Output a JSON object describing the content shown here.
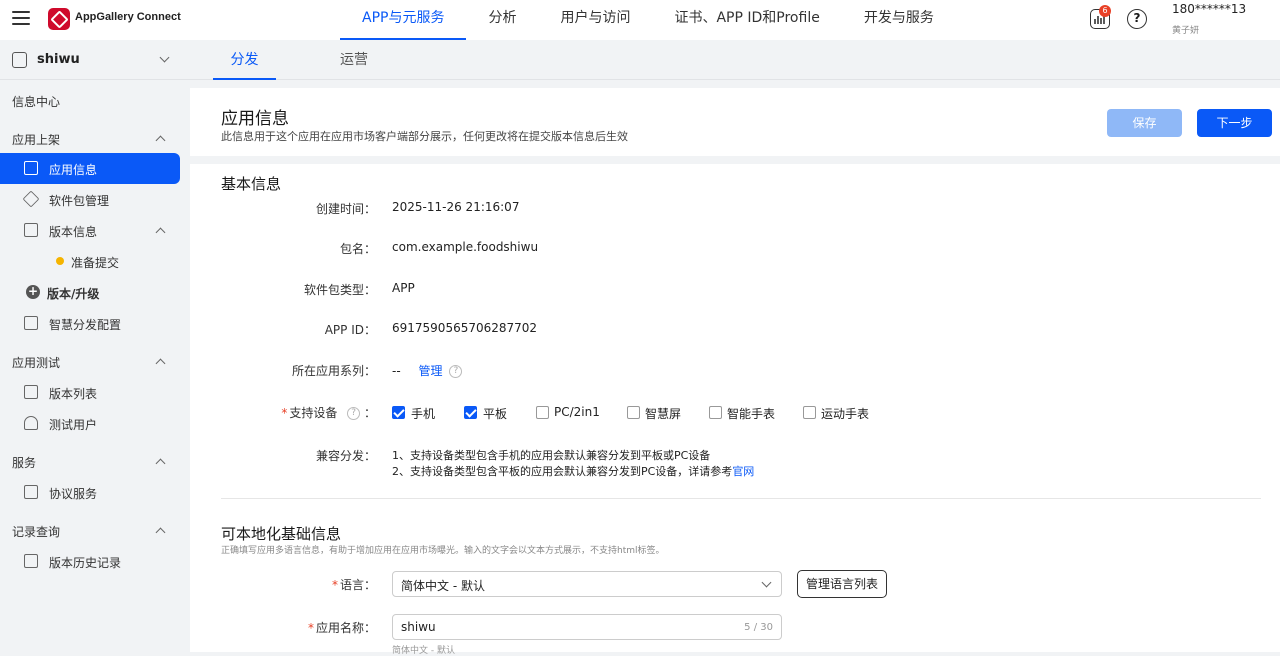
{
  "brand": "AppGallery Connect",
  "nav": {
    "items": [
      "APP与元服务",
      "分析",
      "用户与访问",
      "证书、APP ID和Profile",
      "开发与服务"
    ],
    "active": 0
  },
  "notif_count": "6",
  "help_symbol": "?",
  "user": {
    "name": "180******13",
    "sub": "黄子妍"
  },
  "sidebar": {
    "app_name": "shiwu",
    "info_center": "信息中心",
    "group_listing": "应用上架",
    "app_info": "应用信息",
    "package_mgmt": "软件包管理",
    "version_info": "版本信息",
    "prepare_submit": "准备提交",
    "version_upgrade": "版本/升级",
    "smart_dist": "智慧分发配置",
    "group_test": "应用测试",
    "version_list": "版本列表",
    "test_users": "测试用户",
    "group_service": "服务",
    "agreement_service": "协议服务",
    "group_records": "记录查询",
    "version_history": "版本历史记录"
  },
  "tabs": [
    "分发",
    "运营"
  ],
  "header": {
    "title": "应用信息",
    "desc": "此信息用于这个应用在应用市场客户端部分展示，任何更改将在提交版本信息后生效",
    "save": "保存",
    "next": "下一步"
  },
  "basic": {
    "title": "基本信息",
    "created_label": "创建时间：",
    "created_value": "2025-11-26 21:16:07",
    "pkg_label": "包名：",
    "pkg_value": "com.example.foodshiwu",
    "type_label": "软件包类型：",
    "type_value": "APP",
    "appid_label": "APP ID：",
    "appid_value": "6917590565706287702",
    "series_label": "所在应用系列：",
    "series_value": "--",
    "series_manage": "管理",
    "devices_label": "支持设备",
    "devices_colon": "：",
    "devices": [
      {
        "label": "手机",
        "checked": true
      },
      {
        "label": "平板",
        "checked": true
      },
      {
        "label": "PC/2in1",
        "checked": false
      },
      {
        "label": "智慧屏",
        "checked": false
      },
      {
        "label": "智能手表",
        "checked": false
      },
      {
        "label": "运动手表",
        "checked": false
      }
    ],
    "compat_label": "兼容分发：",
    "compat_line1": "1、支持设备类型包含手机的应用会默认兼容分发到平板或PC设备",
    "compat_line2": "2、支持设备类型包含平板的应用会默认兼容分发到PC设备，详请参考",
    "compat_link": "官网"
  },
  "local": {
    "title": "可本地化基础信息",
    "desc": "正确填写应用多语言信息，有助于增加应用在应用市场曝光。输入的文字会以文本方式展示，不支持html标签。",
    "lang_label": "语言：",
    "lang_value": "简体中文 - 默认",
    "manage_lang": "管理语言列表",
    "name_label": "应用名称：",
    "name_value": "shiwu",
    "name_count": "5 / 30",
    "name_hint": "简体中文 - 默认"
  },
  "colors": {
    "accent": "#0a59f7",
    "save_disabled": "#8fb8f7",
    "required": "#e84026",
    "badge": "#e84026"
  }
}
